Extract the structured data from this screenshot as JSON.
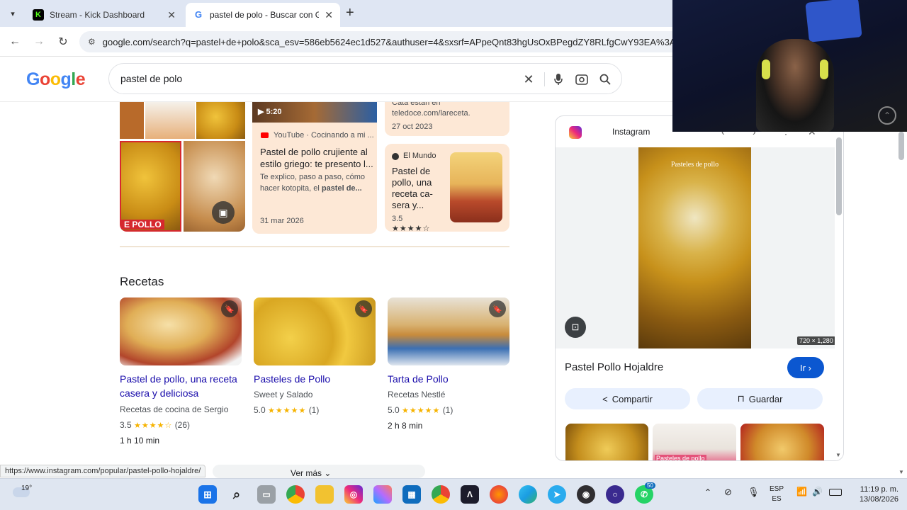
{
  "browser": {
    "tabs": [
      {
        "title": "Stream - Kick Dashboard",
        "active": false
      },
      {
        "title": "pastel de polo - Buscar con Goo",
        "active": true
      }
    ],
    "new_tab": "+",
    "url": "google.com/search?q=pastel+de+polo&sca_esv=586eb5624ec1d527&authuser=4&sxsrf=APpeQnt83hgUsOxBPegdZY8RLfgCwY93EA%3A",
    "status_url": "https://www.instagram.com/popular/pastel-pollo-hojaldre/"
  },
  "google": {
    "logo": "Google",
    "query": "pastel de polo"
  },
  "top_cards": {
    "video": {
      "duration": "5:20",
      "source": "YouTube · Cocinando a mi ...",
      "title": "Pastel de pollo crujiente al estilo griego: te presento l...",
      "snippet_plain": "Te explico, paso a paso, cómo hacer kotopita, el",
      "snippet_bold": "pastel de...",
      "date": "31 mar 2026"
    },
    "article1": {
      "snippet": "Cata están en teledoce.com/lareceta.",
      "date": "27 oct 2023"
    },
    "article2": {
      "source": "El Mundo",
      "title": "Pastel de pollo, una receta ca-sera y...",
      "rating": "3.5"
    },
    "collage_label": "E POLLO"
  },
  "recetas": {
    "heading": "Recetas",
    "items": [
      {
        "title": "Pastel de pollo, una receta casera y deliciosa",
        "source": "Recetas de cocina de Sergio",
        "rating": "3.5",
        "stars": "★★★★☆",
        "count": "(26)",
        "time": "1 h 10 min"
      },
      {
        "title": "Pasteles de Pollo",
        "source": "Sweet y Salado",
        "rating": "5.0",
        "stars": "★★★★★",
        "count": "(1)",
        "time": ""
      },
      {
        "title": "Tarta de Pollo",
        "source": "Recetas Nestlé",
        "rating": "5.0",
        "stars": "★★★★★",
        "count": "(1)",
        "time": "2 h 8 min"
      }
    ],
    "more": "Ver más"
  },
  "side_panel": {
    "source": "Instagram",
    "image_caption": "Pasteles de pollo",
    "dimensions": "720 × 1,280",
    "title": "Pastel Pollo Hojaldre",
    "go_button": "Ir",
    "share_button": "Compartir",
    "save_button": "Guardar",
    "thumb_caption": "Pasteles de pollo"
  },
  "taskbar": {
    "weather": "19°",
    "lang_top": "ESP",
    "lang_bottom": "ES",
    "time": "11:19 p. m.",
    "date": "13/08/2026",
    "badge": "50"
  },
  "colors": {
    "google_blue": "#4285f4",
    "google_red": "#ea4335",
    "google_yellow": "#fbbc05",
    "google_green": "#34a853",
    "link": "#1a0dab",
    "go_button": "#0b57d0"
  }
}
